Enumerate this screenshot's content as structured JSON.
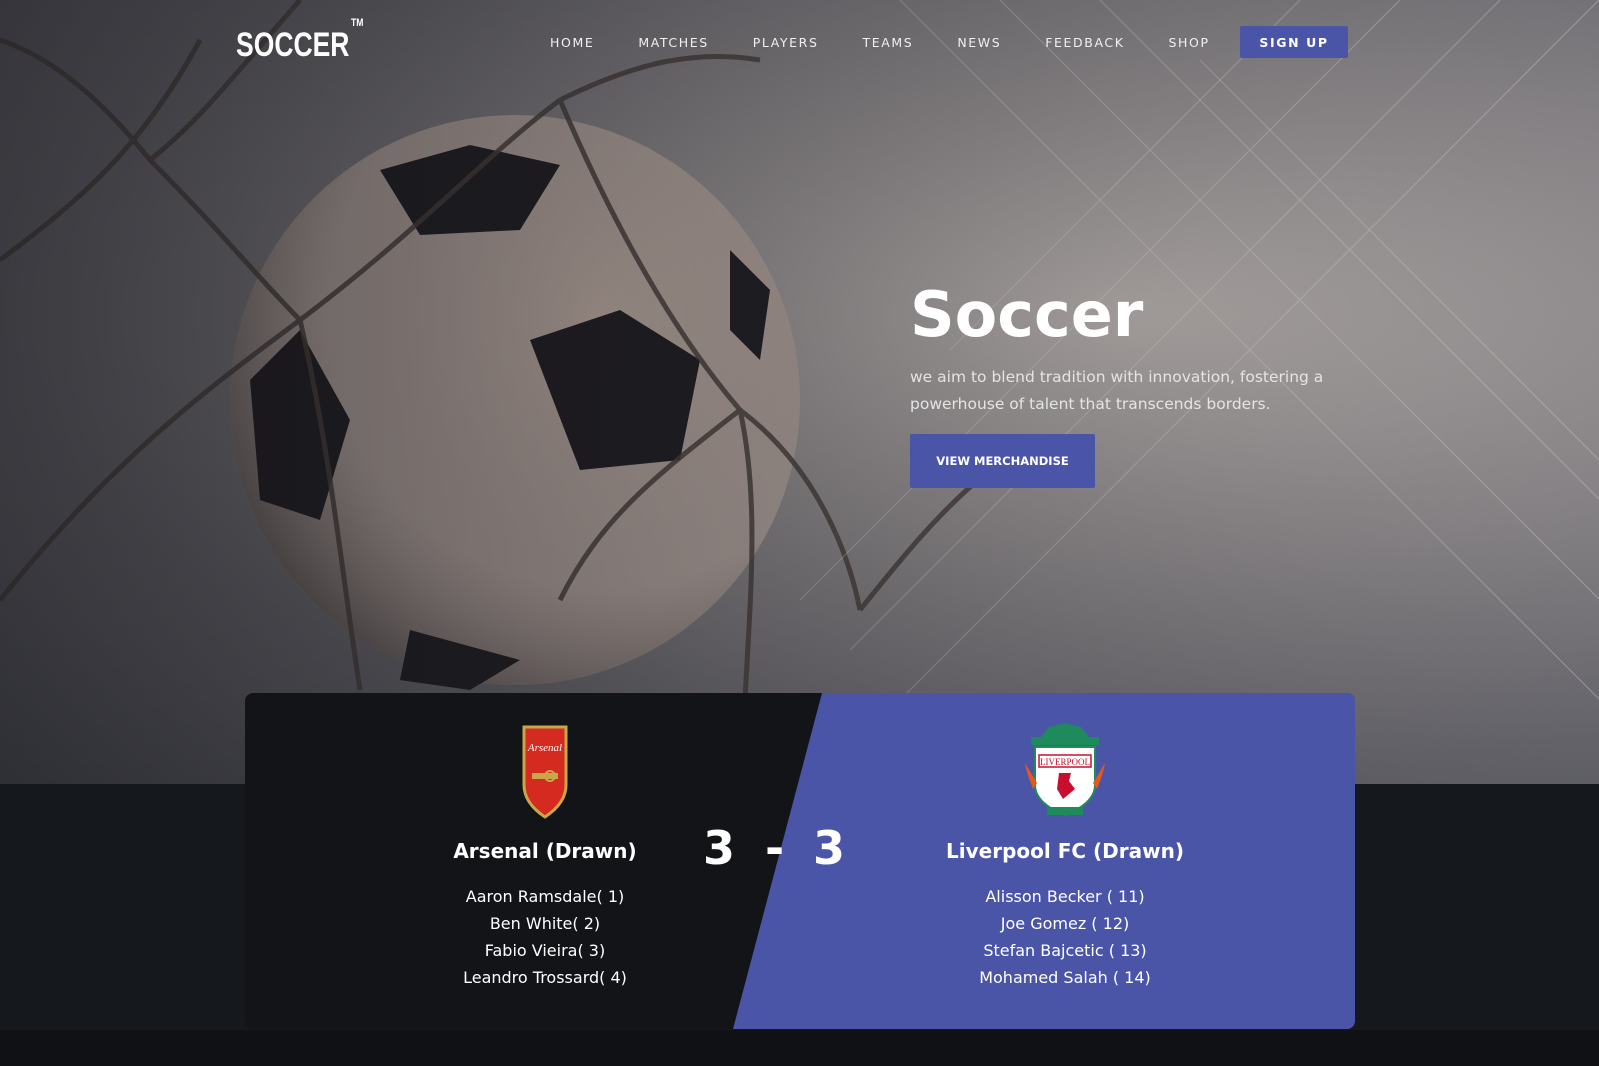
{
  "brand": {
    "logo": "SOCCER",
    "tm": "TM"
  },
  "nav": {
    "items": [
      "HOME",
      "MATCHES",
      "PLAYERS",
      "TEAMS",
      "NEWS",
      "FEEDBACK",
      "SHOP"
    ],
    "signup_label": "SIGN UP"
  },
  "hero": {
    "title": "Soccer",
    "subtitle": "we aim to blend tradition with innovation, fostering a powerhouse of talent that transcends borders.",
    "cta_label": "VIEW MERCHANDISE"
  },
  "match": {
    "home": {
      "name": "Arsenal (Drawn)",
      "crest_text": "Arsenal",
      "players": [
        "Aaron Ramsdale( 1)",
        "Ben White( 2)",
        "Fabio Vieira( 3)",
        "Leandro Trossard( 4)"
      ]
    },
    "away": {
      "name": "Liverpool FC (Drawn)",
      "crest_text": "LIVERPOOL",
      "players": [
        "Alisson Becker ( 11)",
        "Joe Gomez ( 12)",
        "Stefan Bajcetic ( 13)",
        "Mohamed Salah ( 14)"
      ]
    },
    "home_score": "3",
    "separator": "-",
    "away_score": "3"
  },
  "colors": {
    "accent": "#4b55a8",
    "dark": "#121418"
  }
}
